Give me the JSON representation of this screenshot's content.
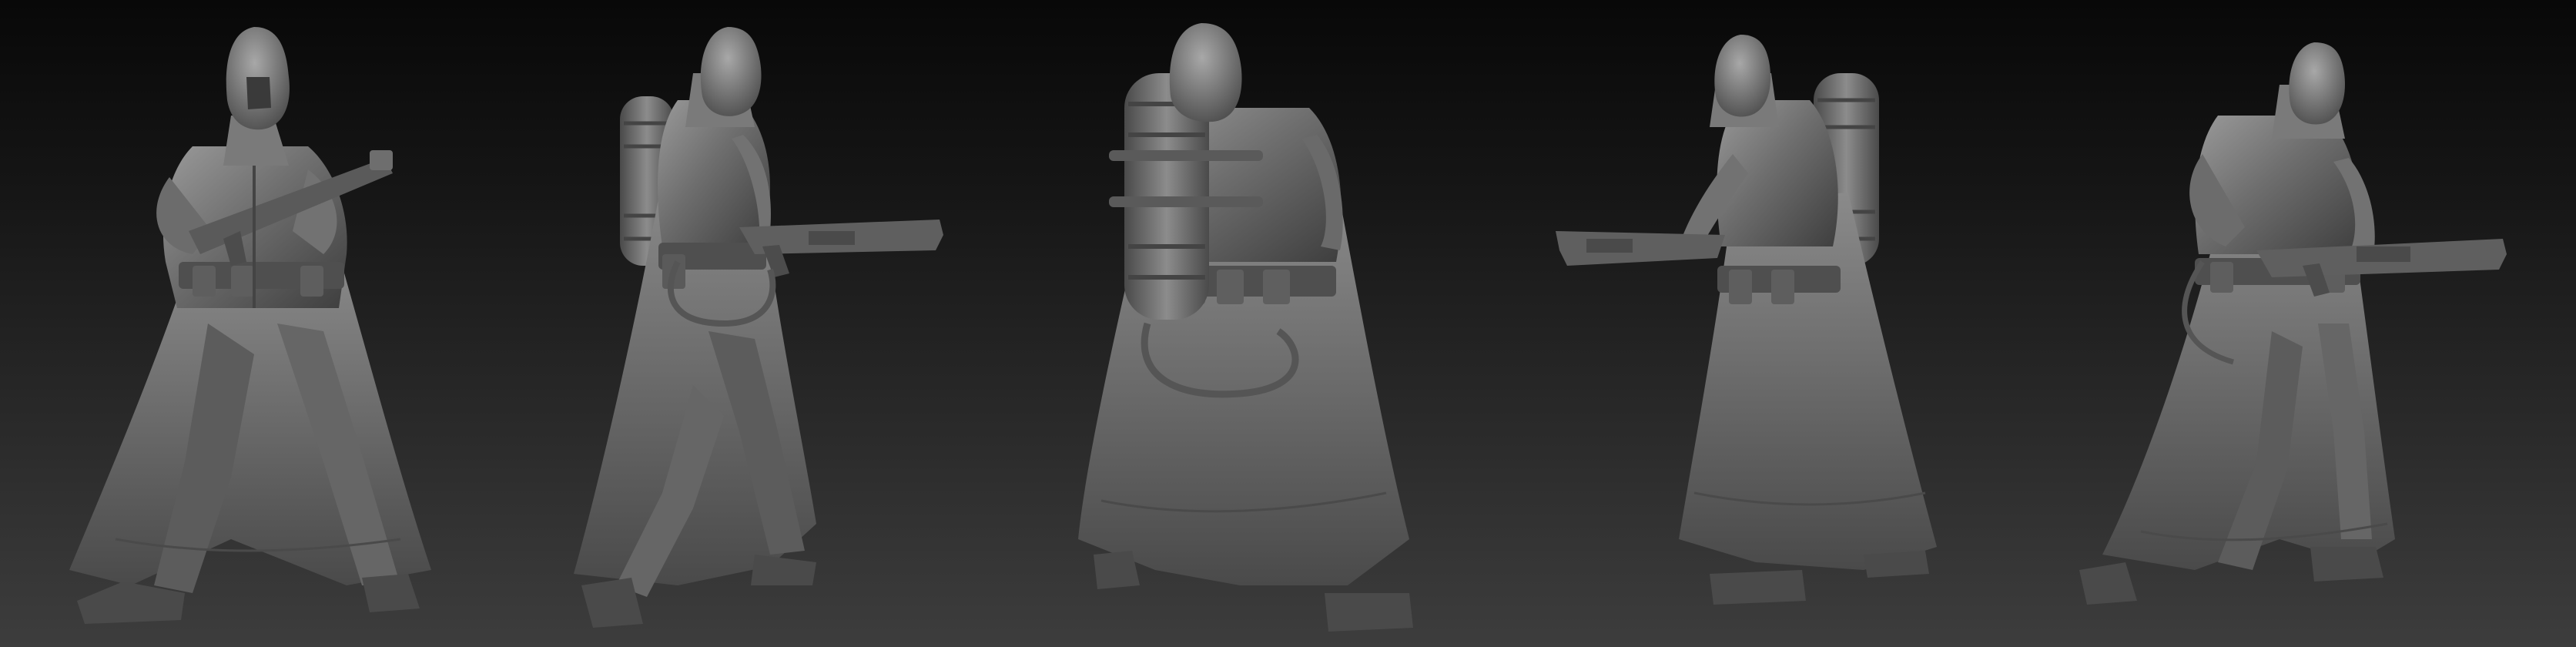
{
  "scene": {
    "kind": "sculpt-turnaround",
    "material": "matte grey clay",
    "background": {
      "top_color": "#080808",
      "bottom_color": "#3d3d3d"
    },
    "clay_colors": {
      "highlight": "#9a9a9a",
      "base": "#6e6e6e",
      "shadow": "#3e3e3e",
      "deep_shadow": "#262626"
    },
    "views": [
      {
        "id": "front-three-quarter",
        "has_backpack_visible": false,
        "gun_side": "right"
      },
      {
        "id": "side-right",
        "has_backpack_visible": true,
        "gun_side": "right"
      },
      {
        "id": "back",
        "has_backpack_visible": true,
        "gun_side": "hidden"
      },
      {
        "id": "side-left",
        "has_backpack_visible": true,
        "gun_side": "left"
      },
      {
        "id": "front-right-three-quarter",
        "has_backpack_visible": false,
        "gun_side": "right"
      }
    ]
  }
}
